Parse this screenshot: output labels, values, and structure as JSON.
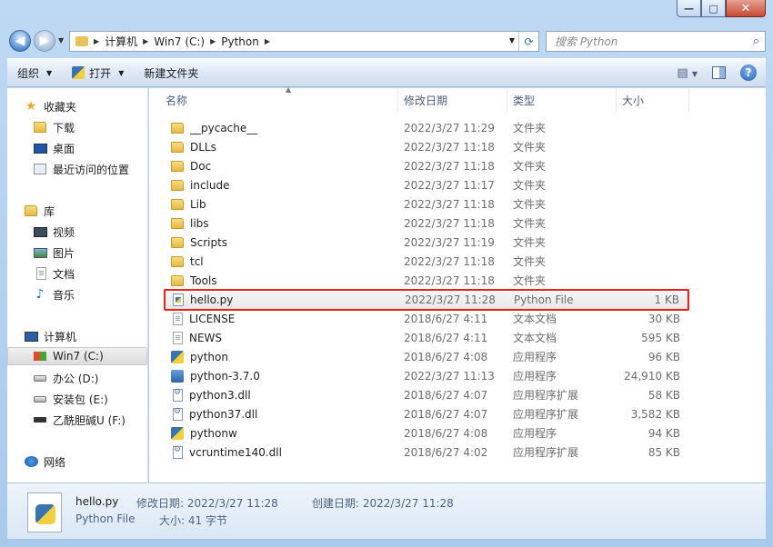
{
  "window": {
    "min": "—",
    "max": "□",
    "close": "✕"
  },
  "address": {
    "crumbs": [
      "计算机",
      "Win7 (C:)",
      "Python"
    ],
    "search_placeholder": "搜索 Python"
  },
  "toolbar": {
    "organize": "组织",
    "open": "打开",
    "new_folder": "新建文件夹",
    "help": "?"
  },
  "sidebar": {
    "favorites": {
      "label": "收藏夹",
      "items": [
        "下载",
        "桌面",
        "最近访问的位置"
      ]
    },
    "libraries": {
      "label": "库",
      "items": [
        "视频",
        "图片",
        "文档",
        "音乐"
      ]
    },
    "computer": {
      "label": "计算机",
      "items": [
        "Win7 (C:)",
        "办公 (D:)",
        "安装包 (E:)",
        "乙酰胆碱U (F:)"
      ]
    },
    "network": {
      "label": "网络"
    }
  },
  "columns": {
    "name": "名称",
    "date": "修改日期",
    "type": "类型",
    "size": "大小"
  },
  "files": [
    {
      "name": "__pycache__",
      "date": "2022/3/27 11:29",
      "type": "文件夹",
      "size": "",
      "icon": "folder"
    },
    {
      "name": "DLLs",
      "date": "2022/3/27 11:18",
      "type": "文件夹",
      "size": "",
      "icon": "folder"
    },
    {
      "name": "Doc",
      "date": "2022/3/27 11:18",
      "type": "文件夹",
      "size": "",
      "icon": "folder"
    },
    {
      "name": "include",
      "date": "2022/3/27 11:17",
      "type": "文件夹",
      "size": "",
      "icon": "folder"
    },
    {
      "name": "Lib",
      "date": "2022/3/27 11:18",
      "type": "文件夹",
      "size": "",
      "icon": "folder"
    },
    {
      "name": "libs",
      "date": "2022/3/27 11:18",
      "type": "文件夹",
      "size": "",
      "icon": "folder"
    },
    {
      "name": "Scripts",
      "date": "2022/3/27 11:19",
      "type": "文件夹",
      "size": "",
      "icon": "folder"
    },
    {
      "name": "tcl",
      "date": "2022/3/27 11:18",
      "type": "文件夹",
      "size": "",
      "icon": "folder"
    },
    {
      "name": "Tools",
      "date": "2022/3/27 11:18",
      "type": "文件夹",
      "size": "",
      "icon": "folder"
    },
    {
      "name": "hello.py",
      "date": "2022/3/27 11:28",
      "type": "Python File",
      "size": "1 KB",
      "icon": "pyfile"
    },
    {
      "name": "LICENSE",
      "date": "2018/6/27 4:11",
      "type": "文本文档",
      "size": "30 KB",
      "icon": "doc"
    },
    {
      "name": "NEWS",
      "date": "2018/6/27 4:11",
      "type": "文本文档",
      "size": "595 KB",
      "icon": "doc"
    },
    {
      "name": "python",
      "date": "2018/6/27 4:08",
      "type": "应用程序",
      "size": "96 KB",
      "icon": "py"
    },
    {
      "name": "python-3.7.0",
      "date": "2022/3/27 11:13",
      "type": "应用程序",
      "size": "24,910 KB",
      "icon": "setup"
    },
    {
      "name": "python3.dll",
      "date": "2018/6/27 4:07",
      "type": "应用程序扩展",
      "size": "58 KB",
      "icon": "dll"
    },
    {
      "name": "python37.dll",
      "date": "2018/6/27 4:07",
      "type": "应用程序扩展",
      "size": "3,582 KB",
      "icon": "dll"
    },
    {
      "name": "pythonw",
      "date": "2018/6/27 4:08",
      "type": "应用程序",
      "size": "94 KB",
      "icon": "py"
    },
    {
      "name": "vcruntime140.dll",
      "date": "2018/6/27 4:02",
      "type": "应用程序扩展",
      "size": "85 KB",
      "icon": "dll"
    }
  ],
  "details": {
    "name": "hello.py",
    "type": "Python File",
    "modified": "修改日期: 2022/3/27 11:28",
    "size": "大小: 41 字节",
    "created": "创建日期: 2022/3/27 11:28"
  },
  "colors": {
    "highlight": "#e8231c"
  }
}
